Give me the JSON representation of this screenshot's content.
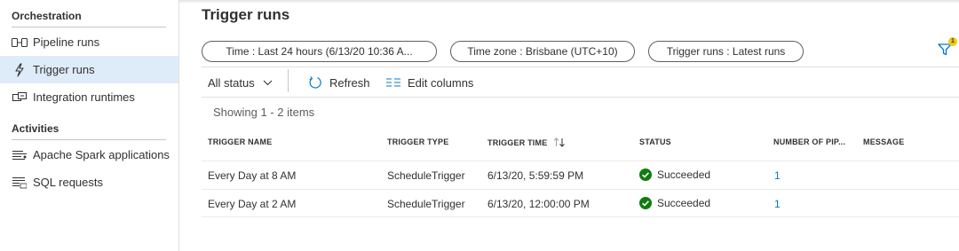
{
  "sidebar": {
    "sections": [
      {
        "heading": "Orchestration"
      },
      {
        "heading": "Activities"
      }
    ],
    "items": [
      {
        "label": "Pipeline runs",
        "icon": "pipeline-runs-icon"
      },
      {
        "label": "Trigger runs",
        "icon": "trigger-runs-icon"
      },
      {
        "label": "Integration runtimes",
        "icon": "integration-runtimes-icon"
      },
      {
        "label": "Apache Spark applications",
        "icon": "spark-applications-icon"
      },
      {
        "label": "SQL requests",
        "icon": "sql-requests-icon"
      }
    ]
  },
  "main": {
    "title": "Trigger runs",
    "filters": [
      {
        "label": "Time : Last 24 hours (6/13/20 10:36 A..."
      },
      {
        "label": "Time zone : Brisbane (UTC+10)"
      },
      {
        "label": "Trigger runs : Latest runs"
      }
    ],
    "filter_badge": "1",
    "toolbar": {
      "status": "All status",
      "refresh": "Refresh",
      "edit_columns": "Edit columns"
    },
    "showing": "Showing 1 - 2 items",
    "columns": [
      "TRIGGER NAME",
      "TRIGGER TYPE",
      "TRIGGER TIME",
      "STATUS",
      "NUMBER OF PIP...",
      "MESSAGE"
    ],
    "rows": [
      {
        "name": "Every Day at 8 AM",
        "type": "ScheduleTrigger",
        "time": "6/13/20, 5:59:59 PM",
        "status": "Succeeded",
        "pipelines": "1",
        "message": ""
      },
      {
        "name": "Every Day at 2 AM",
        "type": "ScheduleTrigger",
        "time": "6/13/20, 12:00:00 PM",
        "status": "Succeeded",
        "pipelines": "1",
        "message": ""
      }
    ]
  },
  "colors": {
    "accent": "#0078d4",
    "success": "#107c10",
    "active_bg": "#deecf9",
    "badge": "#f2c811"
  }
}
